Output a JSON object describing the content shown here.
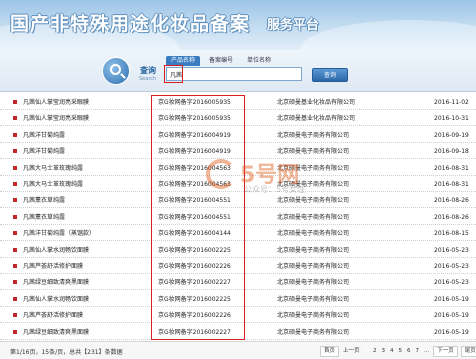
{
  "header": {
    "title": "国产非特殊用途化妆品备案",
    "subtitle": "服务平台"
  },
  "search": {
    "label": "查询",
    "label_en": "Search",
    "tabs": [
      {
        "label": "产品名称",
        "active": true
      },
      {
        "label": "备案编号",
        "active": false
      },
      {
        "label": "单位名称",
        "active": false
      }
    ],
    "query": "凡茜",
    "button_label": "查询"
  },
  "results": [
    {
      "name": "凡茜仙人掌莹润亮采眼膜",
      "reg": "京G妆网备字2016005935",
      "company": "北京硕曼基业化妆品有限公司",
      "date": "2016-11-02"
    },
    {
      "name": "凡茜仙人掌莹润亮采眼膜",
      "reg": "京G妆网备字2016005935",
      "company": "北京硕曼基业化妆品有限公司",
      "date": "2016-10-31"
    },
    {
      "name": "凡茜洋甘菊纯露",
      "reg": "京G妆网备字2016004919",
      "company": "北京硕曼电子商务有限公司",
      "date": "2016-09-19"
    },
    {
      "name": "凡茜洋甘菊纯露",
      "reg": "京G妆网备字2016004919",
      "company": "北京硕曼电子商务有限公司",
      "date": "2016-09-18"
    },
    {
      "name": "凡茜大马士革玫瑰纯露",
      "reg": "京G妆网备字2016004563",
      "company": "北京硕曼电子商务有限公司",
      "date": "2016-08-31"
    },
    {
      "name": "凡茜大马士革玫瑰纯露",
      "reg": "京G妆网备字2016004563",
      "company": "北京硕曼电子商务有限公司",
      "date": "2016-08-31"
    },
    {
      "name": "凡茜薰衣草纯露",
      "reg": "京G妆网备字2016004551",
      "company": "北京硕曼电子商务有限公司",
      "date": "2016-08-26"
    },
    {
      "name": "凡茜薰衣草纯露",
      "reg": "京G妆网备字2016004551",
      "company": "北京硕曼电子商务有限公司",
      "date": "2016-08-26"
    },
    {
      "name": "凡茜洋甘菊纯露（蒸馏款）",
      "reg": "京G妆网备字2016004144",
      "company": "北京硕曼电子商务有限公司",
      "date": "2016-08-15"
    },
    {
      "name": "凡茜仙人掌水润畅饮面膜",
      "reg": "京G妆网备字2016002225",
      "company": "北京硕曼电子商务有限公司",
      "date": "2016-05-23"
    },
    {
      "name": "凡茜芦荟舒活修护面膜",
      "reg": "京G妆网备字2016002226",
      "company": "北京硕曼电子商务有限公司",
      "date": "2016-05-23"
    },
    {
      "name": "凡茜绿豆细致清爽黑面膜",
      "reg": "京G妆网备字2016002227",
      "company": "北京硕曼电子商务有限公司",
      "date": "2016-05-23"
    },
    {
      "name": "凡茜仙人掌水润畅饮面膜",
      "reg": "京G妆网备字2016002225",
      "company": "北京硕曼电子商务有限公司",
      "date": "2016-05-19"
    },
    {
      "name": "凡茜芦荟舒活修护面膜",
      "reg": "京G妆网备字2016002226",
      "company": "北京硕曼电子商务有限公司",
      "date": "2016-05-19"
    },
    {
      "name": "凡茜绿豆细致清爽黑面膜",
      "reg": "京G妆网备字2016002227",
      "company": "北京硕曼电子商务有限公司",
      "date": "2016-05-19"
    }
  ],
  "watermark": {
    "name": "5号网",
    "sub": "公众号：5号女性"
  },
  "pager": {
    "info": "第1/16页，15条/页，总共【231】条数据",
    "first": "首页",
    "prev": "上一页",
    "pages": [
      "1",
      "2",
      "3",
      "4",
      "5",
      "6",
      "7"
    ],
    "ellipsis": "...",
    "next": "下一页",
    "last": "尾页"
  },
  "colors": {
    "brand": "#2a67a8",
    "highlight_box": "#d42020",
    "bullet": "#c0282a"
  }
}
